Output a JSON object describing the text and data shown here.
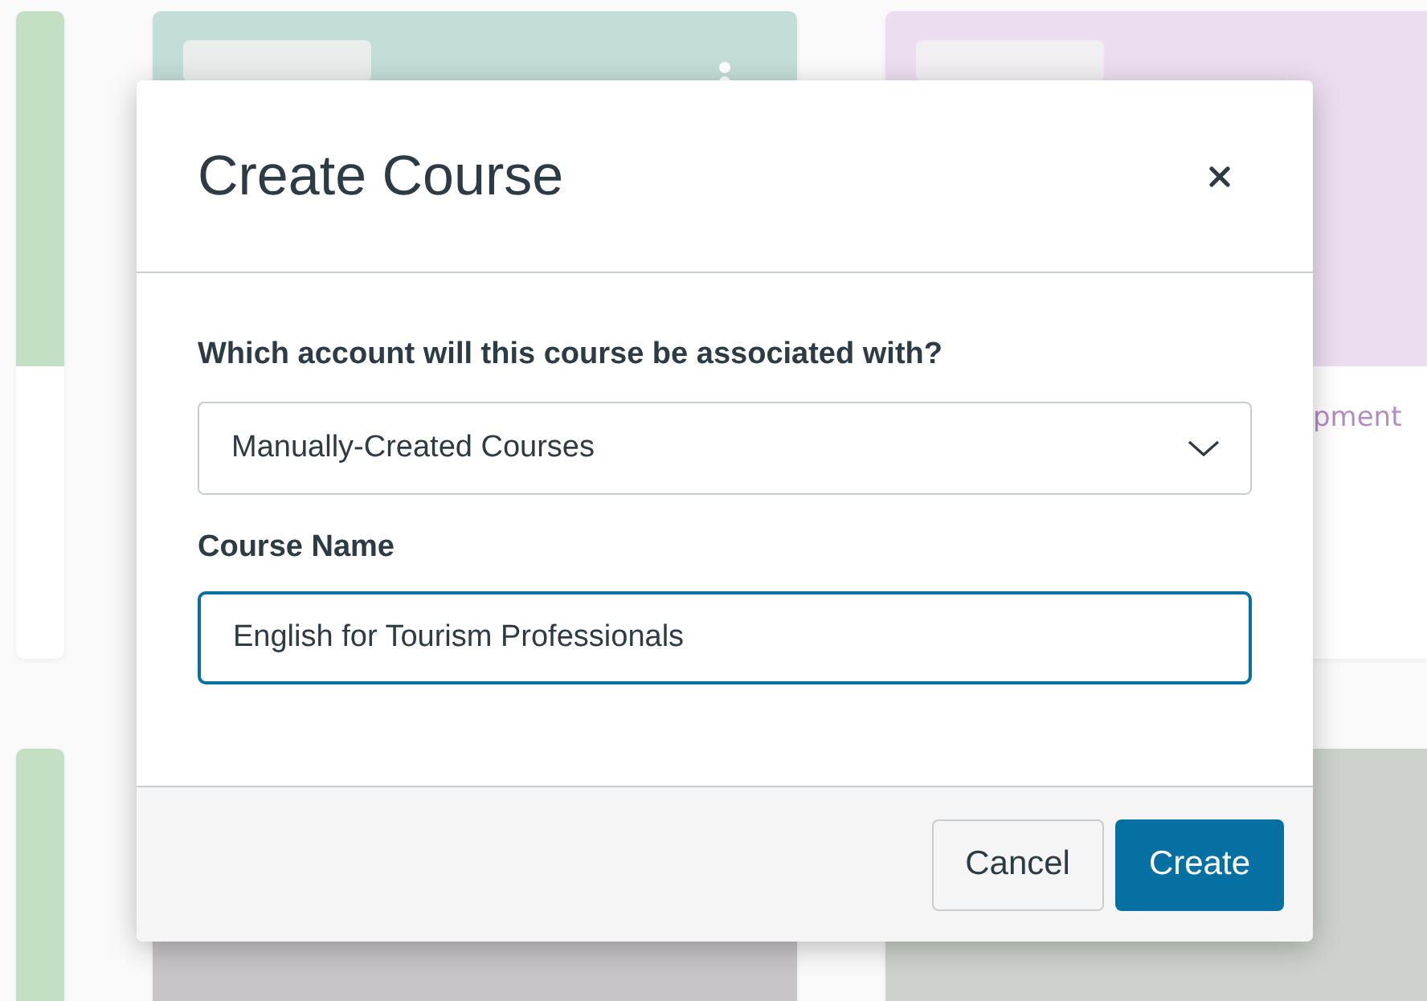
{
  "background_cards": [
    {
      "color": "#c3e0c5"
    },
    {
      "color": "#c3ddd8",
      "has_button": true,
      "has_menu": true
    },
    {
      "color": "#ecdef0",
      "subtitle": "pment",
      "has_button": true
    },
    {
      "color": "#c3e0c5"
    },
    {
      "color": "#c8c4c8"
    },
    {
      "color": "#cdd3cc"
    }
  ],
  "dialog": {
    "title": "Create Course",
    "account_label": "Which account will this course be associated with?",
    "account_value": "Manually-Created Courses",
    "name_label": "Course Name",
    "name_value": "English for Tourism Professionals",
    "buttons": [
      {
        "label": "Cancel",
        "kind": "secondary"
      },
      {
        "label": "Create",
        "kind": "primary"
      }
    ]
  }
}
